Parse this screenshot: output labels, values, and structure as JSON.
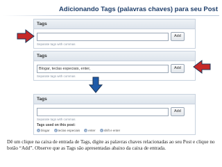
{
  "slide": {
    "title": "Adicionando Tags (palavras chaves) para seu Post",
    "caption": "Dê um clique na caixa de entrada de Tags, digite as palavras chaves relacionadas ao seu Post e clique no botão “Add”. Observe que as Tags são apresentadas abaixo da caixa de entrada."
  },
  "panels": [
    {
      "header": "Tags",
      "input_value": "",
      "add_label": "Add",
      "hint": "Separate tags with commas"
    },
    {
      "header": "Tags",
      "input_value": "Blogar, teclas especiais, enter,",
      "add_label": "Add",
      "hint": "Separate tags with commas"
    },
    {
      "header": "Tags",
      "input_value": "",
      "add_label": "Add",
      "hint": "Separate tags with commas",
      "used_label": "Tags used on this post:",
      "chips": [
        "blogar",
        "teclas especiais",
        "enter",
        "shift e enter"
      ]
    }
  ],
  "colors": {
    "title": "#1f3f6b",
    "arrow_red": "#c62828",
    "arrow_blue": "#1e5aa8",
    "arrow_outline": "#1c3558"
  }
}
